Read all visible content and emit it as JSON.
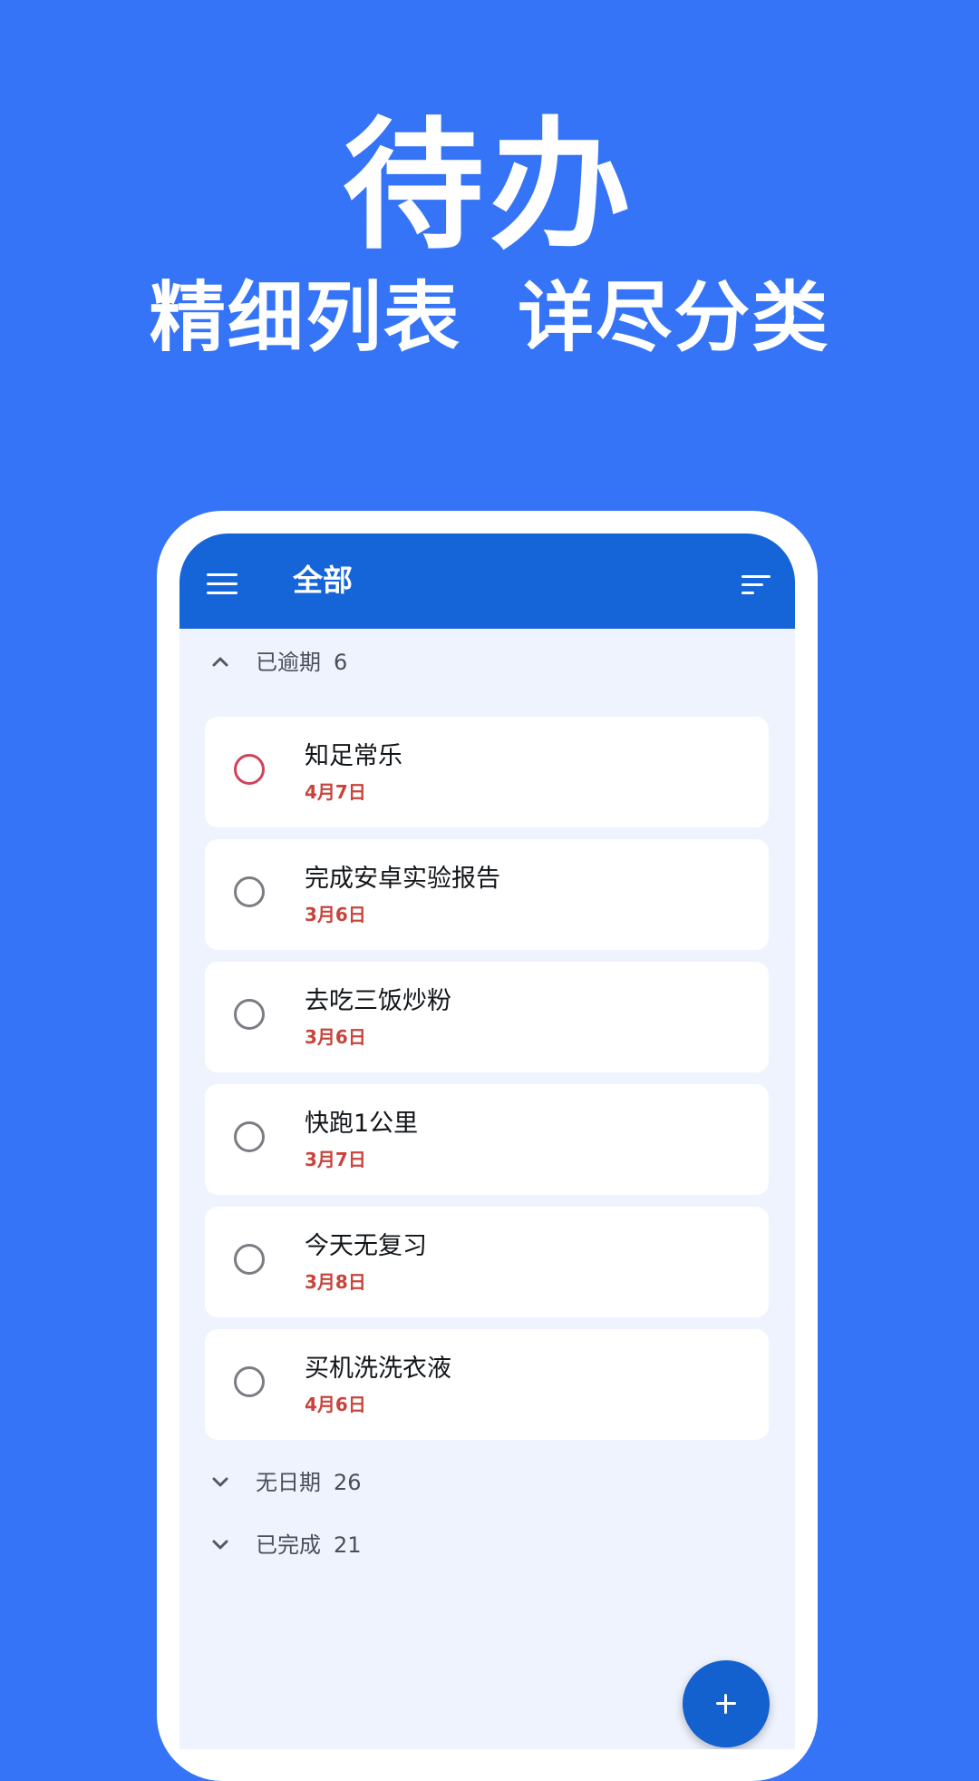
{
  "promo": {
    "title": "待办",
    "subtitle": "精细列表  详尽分类"
  },
  "colors": {
    "background": "#3574f6",
    "appbar": "#1565d8",
    "screen": "#eff3fd",
    "overdue_date": "#c9443c",
    "overdue_check": "#d0435a",
    "fab": "#1360cf"
  },
  "appbar": {
    "menu_icon": "hamburger-menu-icon",
    "title": "全部",
    "sort_icon": "sort-icon"
  },
  "groups": [
    {
      "label": "已逾期",
      "count": "6",
      "expanded": true,
      "chevron": "chevron-up-icon"
    },
    {
      "label": "无日期",
      "count": "26",
      "expanded": false,
      "chevron": "chevron-down-icon"
    },
    {
      "label": "已完成",
      "count": "21",
      "expanded": false,
      "chevron": "chevron-down-icon"
    }
  ],
  "tasks": [
    {
      "title": "知足常乐",
      "date": "4月7日",
      "highlighted": true
    },
    {
      "title": "完成安卓实验报告",
      "date": "3月6日",
      "highlighted": false
    },
    {
      "title": "去吃三饭炒粉",
      "date": "3月6日",
      "highlighted": false
    },
    {
      "title": "快跑1公里",
      "date": "3月7日",
      "highlighted": false
    },
    {
      "title": "今天无复习",
      "date": "3月8日",
      "highlighted": false
    },
    {
      "title": "买机洗洗衣液",
      "date": "4月6日",
      "highlighted": false
    }
  ],
  "fab": {
    "icon": "plus-icon"
  }
}
